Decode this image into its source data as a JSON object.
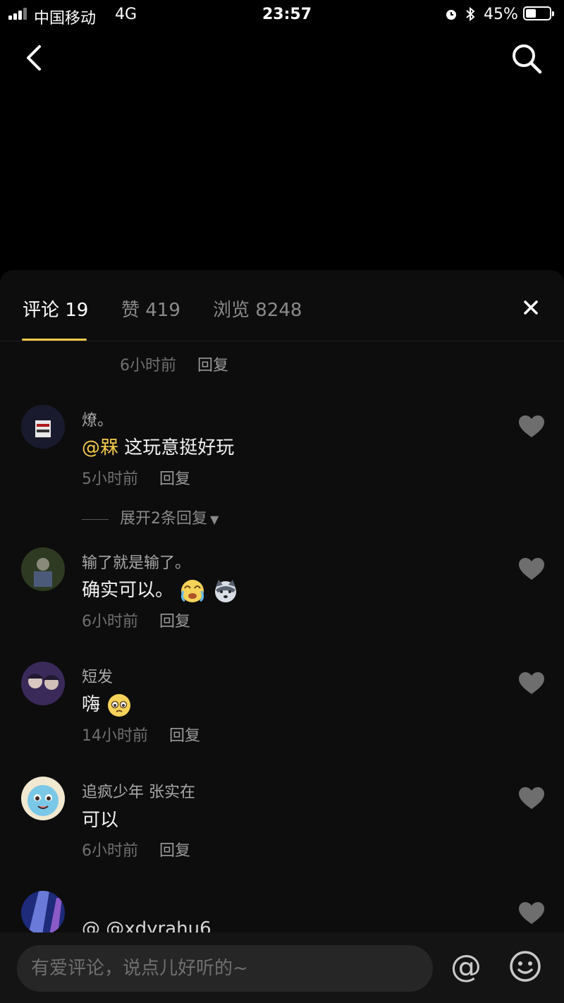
{
  "status_bar": {
    "carrier": "中国移动",
    "network": "4G",
    "time": "23:57",
    "battery": "45%",
    "battery_level": 0.45
  },
  "tabs": [
    {
      "label": "评论 19"
    },
    {
      "label": "赞 419"
    },
    {
      "label": "浏览 8248"
    }
  ],
  "comments": [
    {
      "time": "6小时前",
      "reply": "回复"
    },
    {
      "username": "燎。",
      "mention": "@槑",
      "text": " 这玩意挺好玩",
      "time": "5小时前",
      "reply": "回复",
      "expand": "展开2条回复"
    },
    {
      "username": "输了就是输了。",
      "text": "确实可以。",
      "time": "6小时前",
      "reply": "回复"
    },
    {
      "username": "短发",
      "text": "嗨",
      "time": "14小时前",
      "reply": "回复"
    },
    {
      "username": "追疯少年 张实在",
      "text": "可以",
      "time": "6小时前",
      "reply": "回复"
    },
    {
      "username": "",
      "text": "@ @xdyrahu6"
    }
  ],
  "input": {
    "placeholder": "有爱评论，说点儿好听的~"
  },
  "icons": {
    "back": "back-arrow-icon",
    "search": "search-icon",
    "close": "close-icon",
    "heart": "heart-icon",
    "at": "at-icon",
    "emoji": "emoji-icon"
  },
  "colors": {
    "accent": "#f2c94c",
    "background": "#000000",
    "sheet": "#0d0d0d"
  }
}
